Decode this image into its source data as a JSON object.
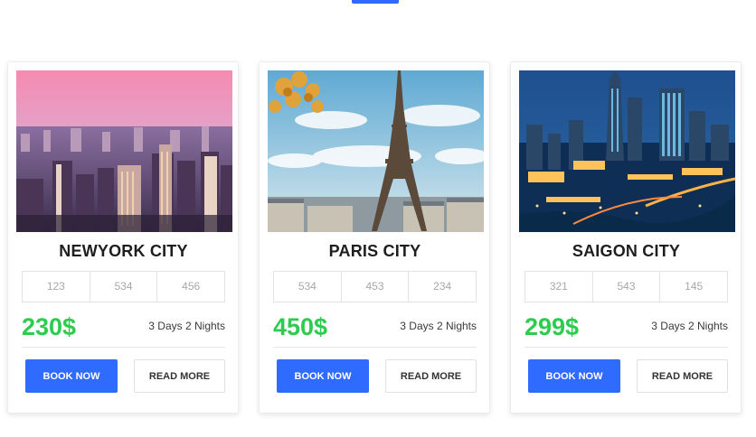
{
  "colors": {
    "accent": "#2f6bff",
    "price": "#2ecc4e"
  },
  "cards": [
    {
      "image": "new-york-skyline-sunset",
      "city": "NEWYORK CITY",
      "stats": [
        "123",
        "534",
        "456"
      ],
      "price": "230$",
      "duration": "3 Days 2 Nights",
      "book_label": "BOOK NOW",
      "more_label": "READ MORE"
    },
    {
      "image": "paris-eiffel-tower",
      "city": "PARIS CITY",
      "stats": [
        "534",
        "453",
        "234"
      ],
      "price": "450$",
      "duration": "3 Days 2 Nights",
      "book_label": "BOOK NOW",
      "more_label": "READ MORE"
    },
    {
      "image": "saigon-night-skyline",
      "city": "SAIGON CITY",
      "stats": [
        "321",
        "543",
        "145"
      ],
      "price": "299$",
      "duration": "3 Days 2 Nights",
      "book_label": "BOOK NOW",
      "more_label": "READ MORE"
    }
  ]
}
